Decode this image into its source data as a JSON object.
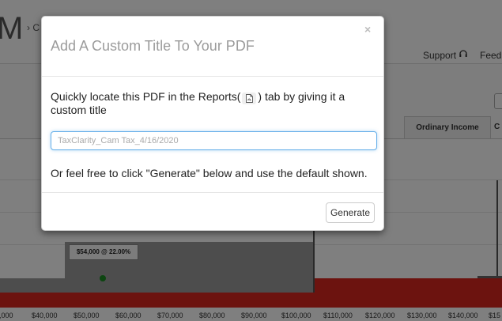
{
  "app": {
    "logo_letter": "M",
    "logo_rest": "› C",
    "nav": {
      "support_label": "Support",
      "feedback_label": "Feedb"
    },
    "tabs": {
      "active_label": "Ordinary Income",
      "next_label": "C"
    }
  },
  "chart_data": {
    "type": "area",
    "x_tick_labels": [
      "0,000",
      "$40,000",
      "$50,000",
      "$60,000",
      "$70,000",
      "$80,000",
      "$90,000",
      "$100,000",
      "$110,000",
      "$120,000",
      "$130,000",
      "$140,000",
      "$15"
    ],
    "annotations": [
      "$54,000 @ 22.00%"
    ],
    "colors": {
      "bracket_fill": "#9a9a9a",
      "income_fill": "#d8261f",
      "marker": "#1a8a22"
    }
  },
  "modal": {
    "title": "Add A Custom Title To Your PDF",
    "close_label": "×",
    "description_before": "Quickly locate this PDF in the Reports(",
    "description_after": ") tab by giving it a custom title",
    "doc_icon": "file-pdf-icon",
    "input": {
      "placeholder": "TaxClarity_Cam Tax_4/16/2020",
      "value": ""
    },
    "note": "Or feel free to click \"Generate\" below and use the default shown.",
    "generate_label": "Generate"
  }
}
